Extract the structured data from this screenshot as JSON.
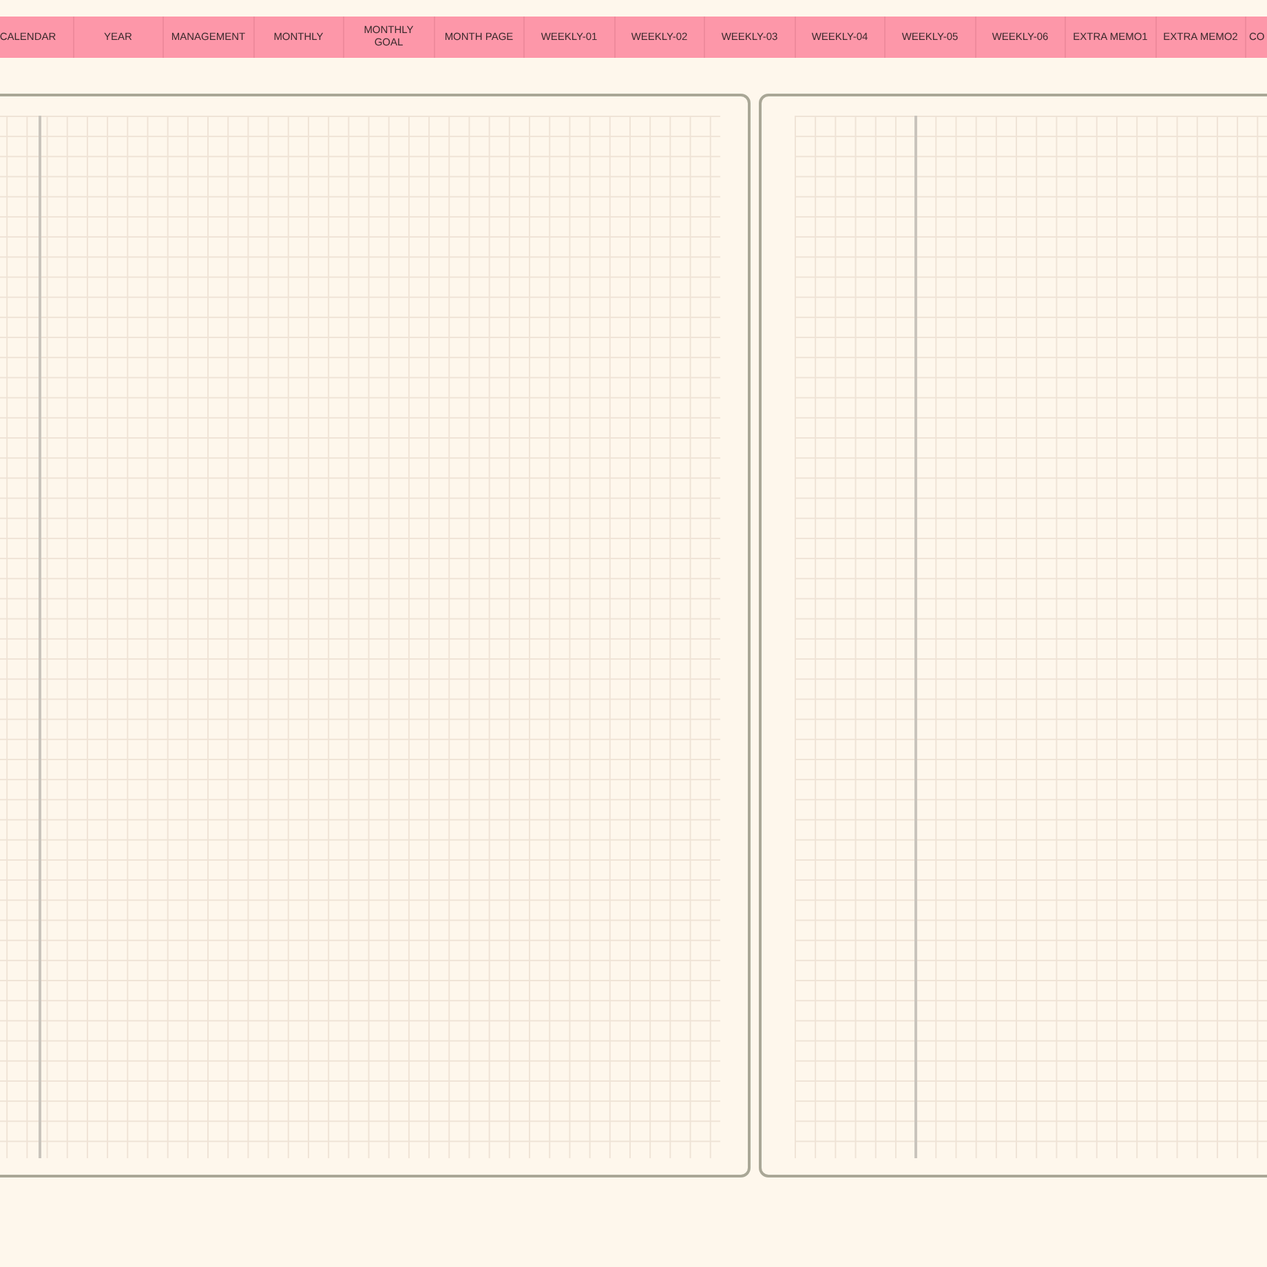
{
  "tabs": [
    {
      "label": "CALENDAR"
    },
    {
      "label": "YEAR"
    },
    {
      "label": "MANAGEMENT"
    },
    {
      "label": "MONTHLY"
    },
    {
      "label": "MONTHLY GOAL"
    },
    {
      "label": "MONTH PAGE"
    },
    {
      "label": "WEEKLY-01"
    },
    {
      "label": "WEEKLY-02"
    },
    {
      "label": "WEEKLY-03"
    },
    {
      "label": "WEEKLY-04"
    },
    {
      "label": "WEEKLY-05"
    },
    {
      "label": "WEEKLY-06"
    },
    {
      "label": "EXTRA MEMO1"
    },
    {
      "label": "EXTRA MEMO2"
    },
    {
      "label": "CO"
    }
  ]
}
